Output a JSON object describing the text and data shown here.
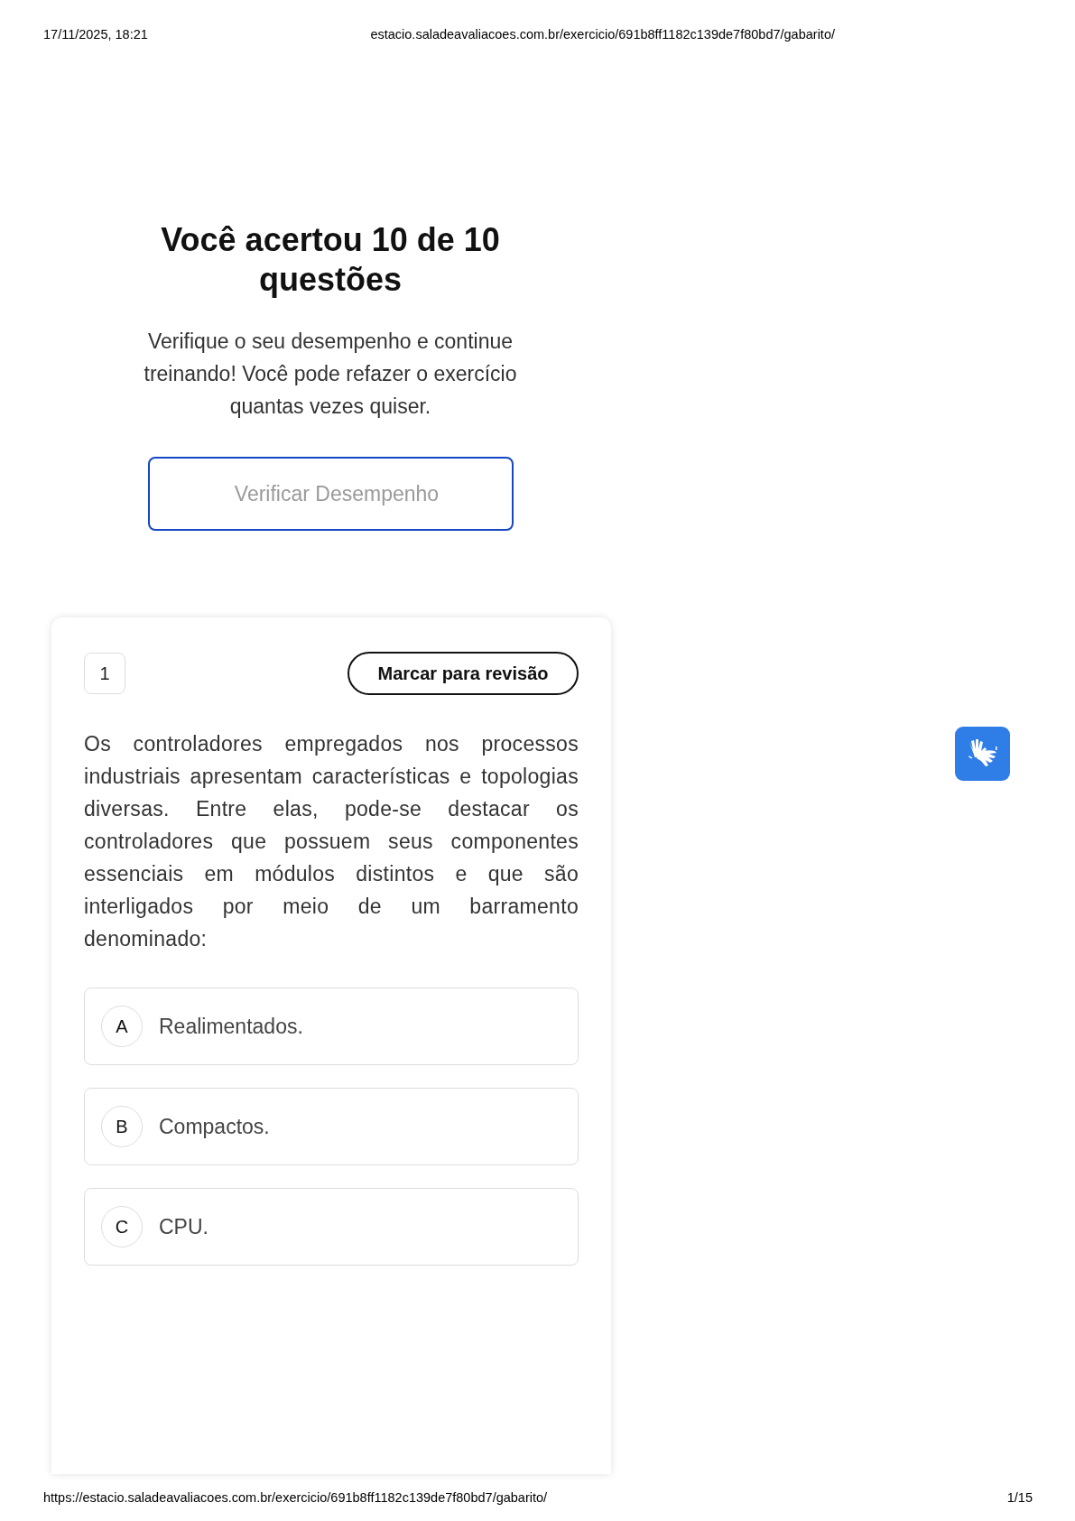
{
  "print_header": {
    "date": "17/11/2025, 18:21",
    "url": "estacio.saladeavaliacoes.com.br/exercicio/691b8ff1182c139de7f80bd7/gabarito/"
  },
  "result": {
    "title": "Você acertou 10 de 10 questões",
    "message": "Verifique o seu desempenho e continue treinando! Você pode refazer o exercício quantas vezes quiser.",
    "button": "Verificar Desempenho"
  },
  "question": {
    "number": "1",
    "review_button": "Marcar para revisão",
    "text": "Os controladores empregados nos processos industriais apresentam características e topologias diversas. Entre elas, pode-se destacar os controladores que possuem seus componentes essenciais em módulos distintos e que são interligados por meio de um barramento denominado:",
    "options": [
      {
        "letter": "A",
        "text": "Realimentados."
      },
      {
        "letter": "B",
        "text": "Compactos."
      },
      {
        "letter": "C",
        "text": "CPU."
      }
    ]
  },
  "print_footer": {
    "url": "https://estacio.saladeavaliacoes.com.br/exercicio/691b8ff1182c139de7f80bd7/gabarito/",
    "page": "1/15"
  }
}
